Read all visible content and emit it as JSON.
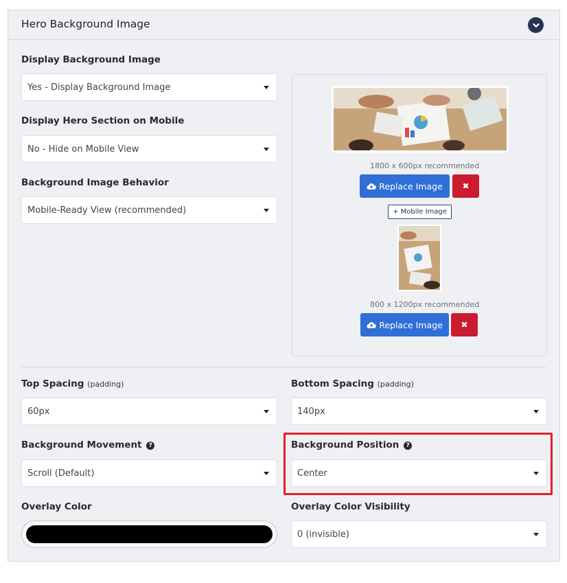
{
  "panel": {
    "title": "Hero Background Image"
  },
  "fields": {
    "display_bg_image": {
      "label": "Display Background Image",
      "value": "Yes - Display Background Image"
    },
    "display_hero_mobile": {
      "label": "Display Hero Section on Mobile",
      "value": "No - Hide on Mobile View"
    },
    "bg_image_behavior": {
      "label": "Background Image Behavior",
      "value": "Mobile-Ready View (recommended)"
    },
    "top_spacing": {
      "label": "Top Spacing",
      "sub": "(padding)",
      "value": "60px"
    },
    "bottom_spacing": {
      "label": "Bottom Spacing",
      "sub": "(padding)",
      "value": "140px"
    },
    "bg_movement": {
      "label": "Background Movement",
      "value": "Scroll (Default)"
    },
    "bg_position": {
      "label": "Background Position",
      "value": "Center"
    },
    "overlay_color": {
      "label": "Overlay Color",
      "value": "#000000"
    },
    "overlay_visibility": {
      "label": "Overlay Color Visibility",
      "value": "0 (invisible)"
    }
  },
  "images": {
    "desktop_recommendation": "1800 x 600px recommended",
    "mobile_recommendation": "800 x 1200px recommended",
    "replace_label": "Replace Image",
    "remove_label": "✖",
    "add_mobile_label": "+ Mobile Image"
  },
  "colors": {
    "primary": "#2f6fd6",
    "danger": "#cc1b2e",
    "highlight": "#e0212b",
    "header_icon_bg": "#233650"
  },
  "icons": {
    "collapse": "chevron-down-icon",
    "upload": "cloud-upload-icon",
    "help": "question-circle-icon",
    "dropdown": "caret-down-icon"
  }
}
